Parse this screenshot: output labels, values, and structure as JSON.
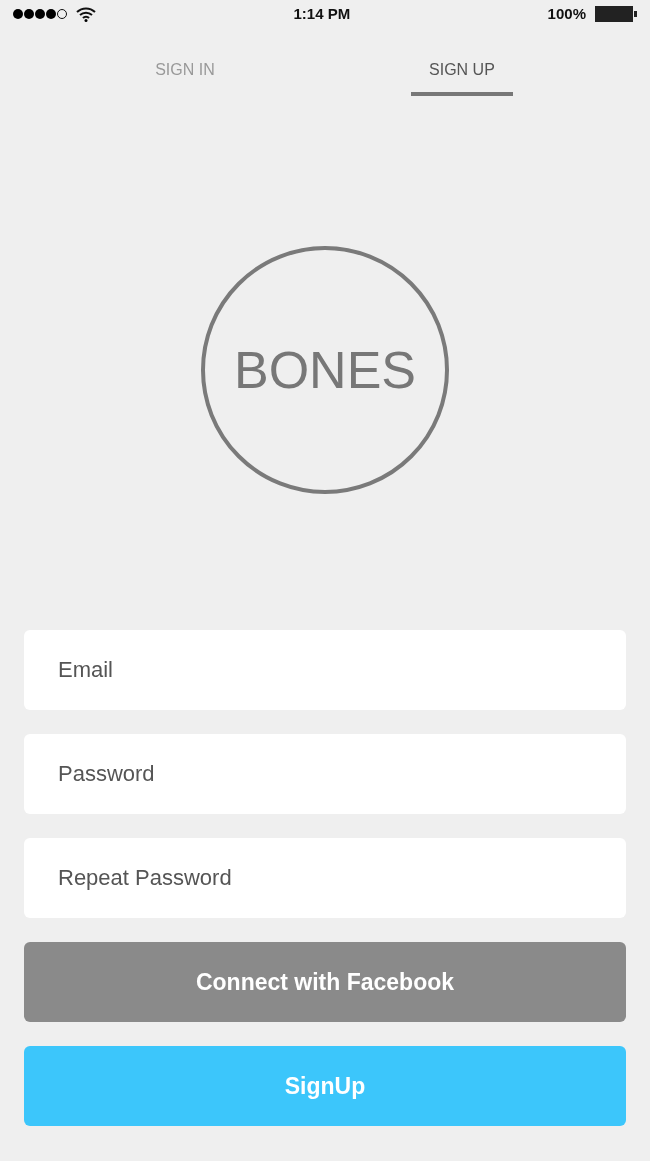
{
  "status_bar": {
    "time": "1:14 PM",
    "battery": "100%"
  },
  "tabs": [
    {
      "label": "SIGN IN",
      "selected": false
    },
    {
      "label": "SIGN UP",
      "selected": true
    }
  ],
  "logo": {
    "text": "BONES"
  },
  "fields": [
    {
      "placeholder": "Email"
    },
    {
      "placeholder": "Password"
    },
    {
      "placeholder": "Repeat Password"
    }
  ],
  "buttons": [
    {
      "label": "Connect with Facebook",
      "kind": "facebook"
    },
    {
      "label": "SignUp",
      "kind": "primary"
    }
  ]
}
